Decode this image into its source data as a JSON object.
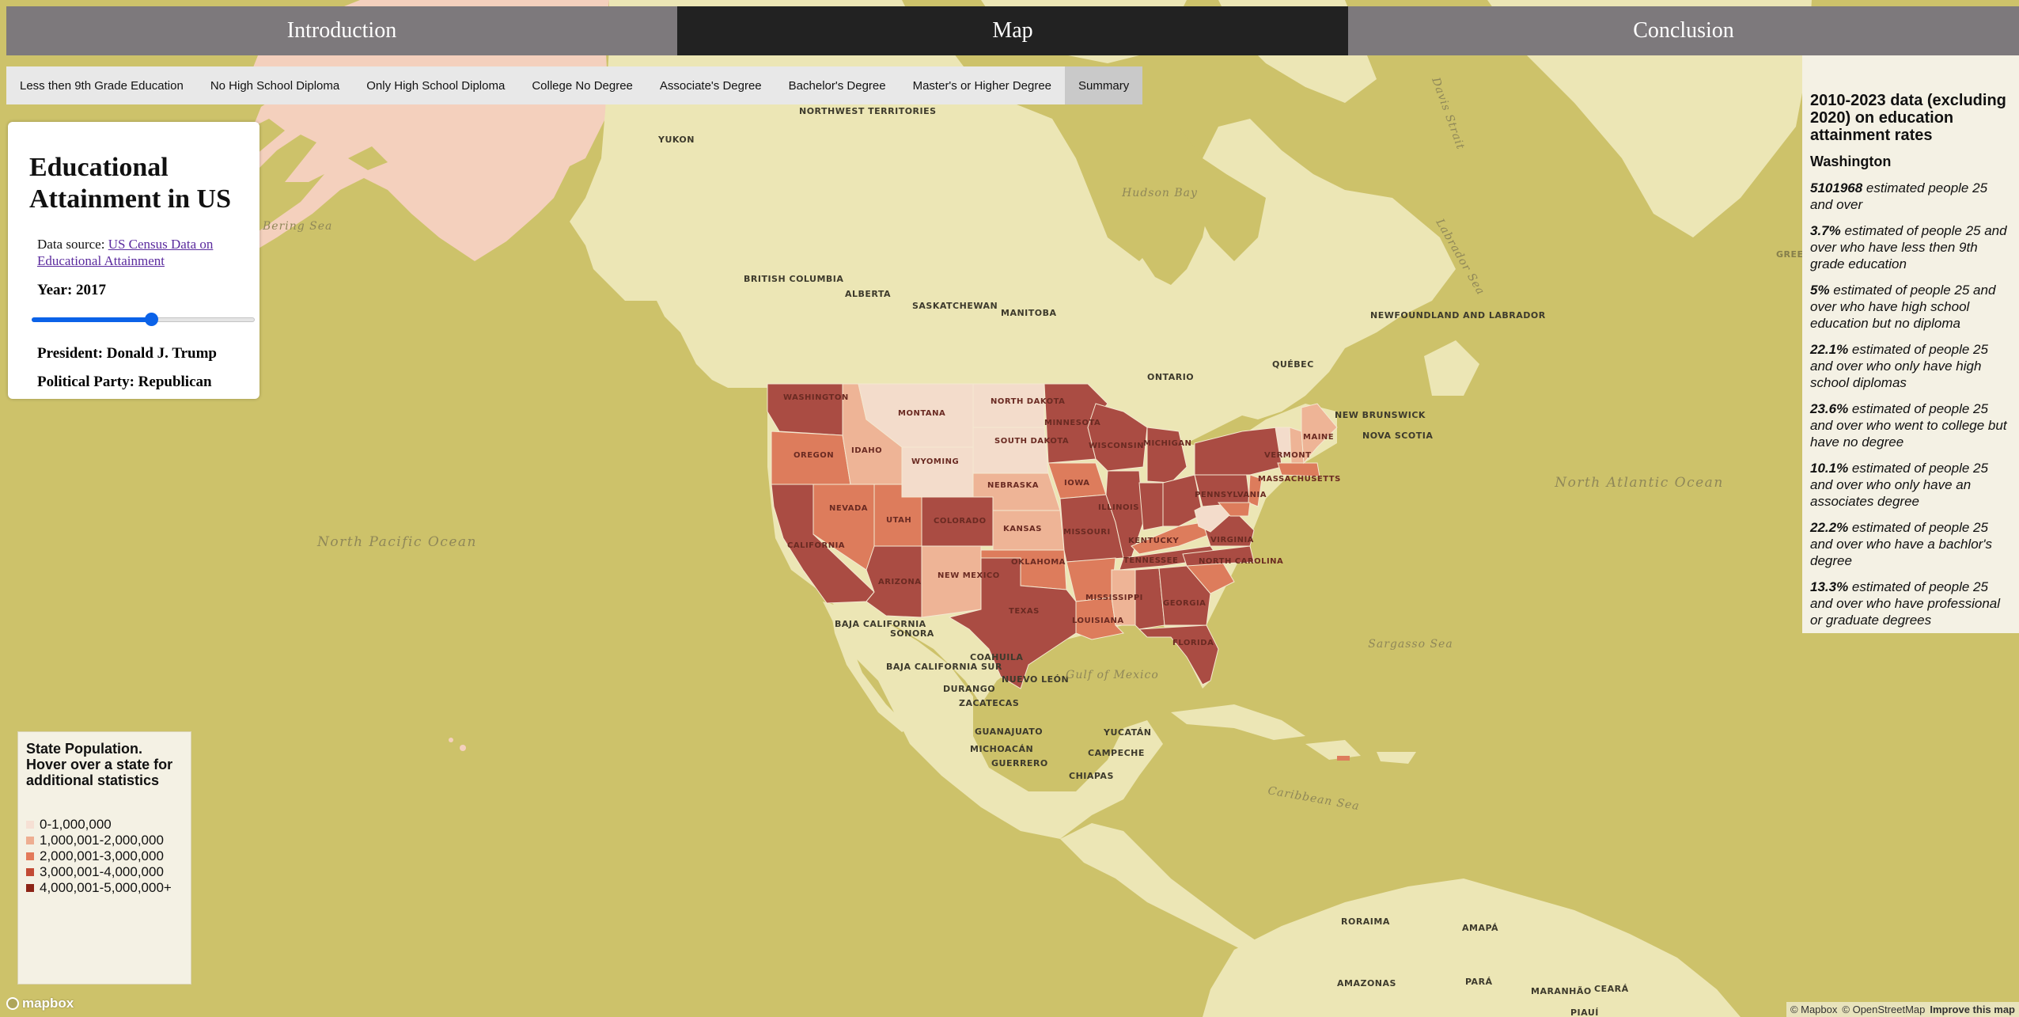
{
  "nav": {
    "tabs": [
      {
        "label": "Introduction",
        "active": false
      },
      {
        "label": "Map",
        "active": true
      },
      {
        "label": "Conclusion",
        "active": false
      }
    ]
  },
  "subnav": {
    "tabs": [
      {
        "label": "Less then 9th Grade Education",
        "active": false
      },
      {
        "label": "No High School Diploma",
        "active": false
      },
      {
        "label": "Only High School Diploma",
        "active": false
      },
      {
        "label": "College No Degree",
        "active": false
      },
      {
        "label": "Associate's Degree",
        "active": false
      },
      {
        "label": "Bachelor's Degree",
        "active": false
      },
      {
        "label": "Master's or Higher Degree",
        "active": false
      },
      {
        "label": "Summary",
        "active": true
      }
    ]
  },
  "info_panel": {
    "title": "Educational Attainment in US",
    "source_prefix": "Data source:",
    "source_link_text": "US Census Data on Educational Attainment",
    "year_label": "Year: 2017",
    "slider": {
      "min": 2010,
      "max": 2023,
      "value": 2017
    },
    "president": "President: Donald J. Trump",
    "party": "Political Party: Republican"
  },
  "stats_panel": {
    "heading": "2010-2023 data (excluding 2020) on education attainment rates",
    "state": "Washington",
    "items": [
      {
        "value": "5101968",
        "text": " estimated people 25 and over"
      },
      {
        "value": "3.7%",
        "text": " estimated of people 25 and over who have less then 9th grade education"
      },
      {
        "value": "5%",
        "text": " estimated of people 25 and over who have high school education but no diploma"
      },
      {
        "value": "22.1%",
        "text": " estimated of people 25 and over who only have high school diplomas"
      },
      {
        "value": "23.6%",
        "text": " estimated of people 25 and over who went to college but have no degree"
      },
      {
        "value": "10.1%",
        "text": " estimated of people 25 and over who only have an associates degree"
      },
      {
        "value": "22.2%",
        "text": " estimated of people 25 and over who have a bachlor's degree"
      },
      {
        "value": "13.3%",
        "text": " estimated of people 25 and over who have professional or graduate degrees"
      }
    ]
  },
  "legend": {
    "title": "State Population. Hover over a state for additional statistics",
    "items": [
      {
        "label": "0-1,000,000",
        "color": "#f6e0d4"
      },
      {
        "label": "1,000,001-2,000,000",
        "color": "#eeae91"
      },
      {
        "label": "2,000,001-3,000,000",
        "color": "#e37a5a"
      },
      {
        "label": "3,000,001-4,000,000",
        "color": "#c24a34"
      },
      {
        "label": "4,000,001-5,000,000+",
        "color": "#8c2416"
      }
    ]
  },
  "map": {
    "colors": {
      "water": "#cdc26a",
      "land": "#ece6b5",
      "alaska_fill": "#f4d0bd",
      "state_lightest": "#f3dccb",
      "state_light": "#eeb496",
      "state_mid": "#dd7c5c",
      "state_dark": "#aa4c43"
    },
    "place_labels": {
      "yukon": "YUKON",
      "nwt": "NORTHWEST TERRITORIES",
      "bc": "BRITISH COLUMBIA",
      "alberta": "ALBERTA",
      "sask": "SASKATCHEWAN",
      "manitoba": "MANITOBA",
      "ontario": "ONTARIO",
      "quebec": "QUÉBEC",
      "nfl": "NEWFOUNDLAND AND LABRADOR",
      "nb": "NEW BRUNSWICK",
      "ns": "NOVA SCOTIA",
      "baja_ca": "BAJA CALIFORNIA",
      "sonora": "SONORA",
      "baja_sur": "BAJA CALIFORNIA SUR",
      "coahuila": "COAHUILA",
      "nuevo_leon": "NUEVO LEÓN",
      "durango": "DURANGO",
      "zacatecas": "ZACATECAS",
      "guanajuato": "GUANAJUATO",
      "michoacan": "MICHOACÁN",
      "guerrero": "GUERRERO",
      "yucatan": "YUCATÁN",
      "campeche": "CAMPECHE",
      "chiapas": "CHIAPAS",
      "roraima": "RORAIMA",
      "amapa": "AMAPÁ",
      "amazonas": "AMAZONAS",
      "para": "PARÁ",
      "maranhao": "MARANHÃO",
      "ceara": "CEARÁ",
      "piaui": "PIAUÍ",
      "greenland": "GREENLAND"
    },
    "water_labels": {
      "hudson": "Hudson Bay",
      "davis": "Davis Strait",
      "labrador": "Labrador Sea",
      "north_pacific": "North Pacific Ocean",
      "north_atlantic": "North Atlantic Ocean",
      "sargasso": "Sargasso Sea",
      "gulf": "Gulf of Mexico",
      "caribbean": "Caribbean Sea",
      "bering": "Bering Sea"
    },
    "state_labels": {
      "wa": "WASHINGTON",
      "or": "OREGON",
      "ca": "CALIFORNIA",
      "nv": "NEVADA",
      "id": "IDAHO",
      "mt": "MONTANA",
      "wy": "WYOMING",
      "ut": "UTAH",
      "az": "ARIZONA",
      "co": "COLORADO",
      "nm": "NEW MEXICO",
      "nd": "NORTH DAKOTA",
      "sd": "SOUTH DAKOTA",
      "ne": "NEBRASKA",
      "ks": "KANSAS",
      "ok": "OKLAHOMA",
      "tx": "TEXAS",
      "mn": "MINNESOTA",
      "ia": "IOWA",
      "mo": "MISSOURI",
      "la": "LOUISIANA",
      "wi": "WISCONSIN",
      "il": "ILLINOIS",
      "mi": "MICHIGAN",
      "ms": "MISSISSIPPI",
      "tn": "TENNESSEE",
      "ky": "KENTUCKY",
      "ga": "GEORGIA",
      "fl": "FLORIDA",
      "pa": "PENNSYLVANIA",
      "va": "VIRGINIA",
      "nc": "NORTH CAROLINA",
      "vt": "VERMONT",
      "me": "MAINE",
      "ma": "MASSACHUSETTS"
    }
  },
  "footer": {
    "logo_text": "mapbox",
    "attribution_mapbox": "© Mapbox",
    "attribution_osm": "© OpenStreetMap",
    "improve": "Improve this map"
  }
}
